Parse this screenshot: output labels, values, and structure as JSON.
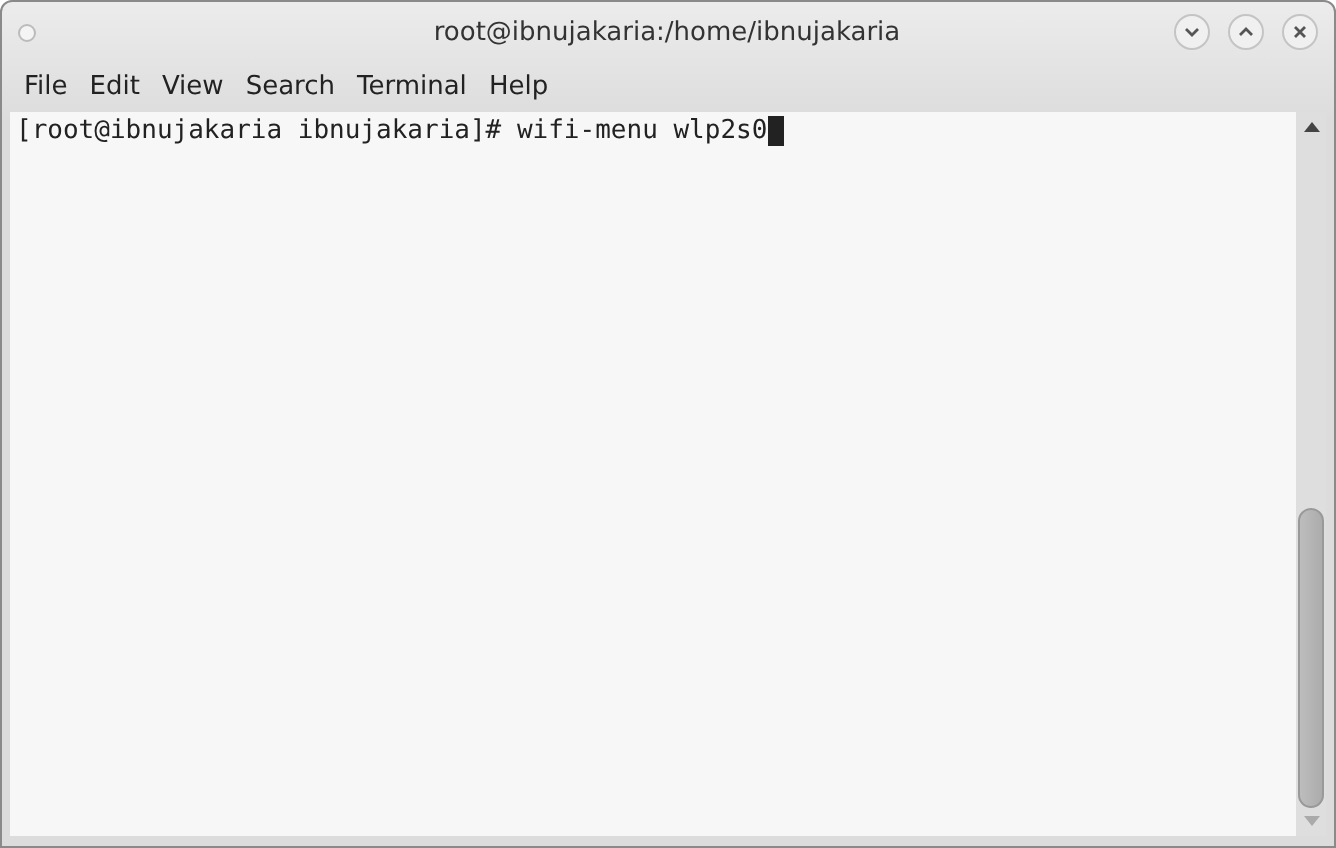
{
  "window": {
    "title": "root@ibnujakaria:/home/ibnujakaria"
  },
  "menu": [
    "File",
    "Edit",
    "View",
    "Search",
    "Terminal",
    "Help"
  ],
  "terminal": {
    "lines": [
      "[root@ibnujakaria ibnujakaria]# wifi-menu wlp2s0"
    ]
  }
}
